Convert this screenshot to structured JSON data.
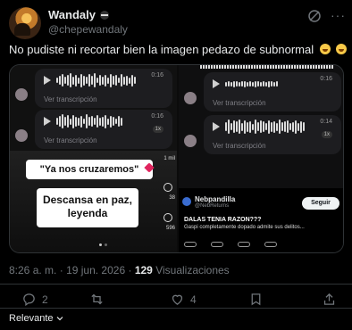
{
  "author": {
    "name": "Wandaly",
    "handle": "@chepewandaly"
  },
  "tweet": {
    "text": "No pudiste ni recortar bien la imagen pedazo de subnormal"
  },
  "media": {
    "voice_notes_left": [
      {
        "time": "0:16",
        "transcript": "Ver transcripción"
      },
      {
        "time": "0:16",
        "speed": "1x",
        "transcript": "Ver transcripción"
      }
    ],
    "voice_notes_right": [
      {
        "time": "0:16",
        "transcript": "Ver transcripción"
      },
      {
        "time": "0:14",
        "speed": "1x",
        "transcript": "Ver transcripción"
      }
    ],
    "meme": {
      "caption_top": "\"Ya nos cruzaremos\"",
      "caption_main": "Descansa en paz, leyenda",
      "side_counts": [
        "1 mil",
        "38",
        "596"
      ]
    },
    "embedded_post": {
      "name": "Nebpandilla",
      "handle": "@NebReturns",
      "follow_label": "Seguir",
      "title": "DALAS TENIA RAZON???",
      "body": "Gaspi completamente dopado admite sus delitos..."
    }
  },
  "meta": {
    "time": "8:26 a. m.",
    "date": "19 jun. 2026",
    "views_count": "129",
    "views_label": "Visualizaciones"
  },
  "actions": {
    "reply_count": "2",
    "like_count": "4"
  },
  "sort": {
    "label": "Relevante"
  },
  "colors": {
    "background": "#000000",
    "text": "#e7e9ea",
    "muted": "#71767b",
    "divider": "#2f3336"
  }
}
